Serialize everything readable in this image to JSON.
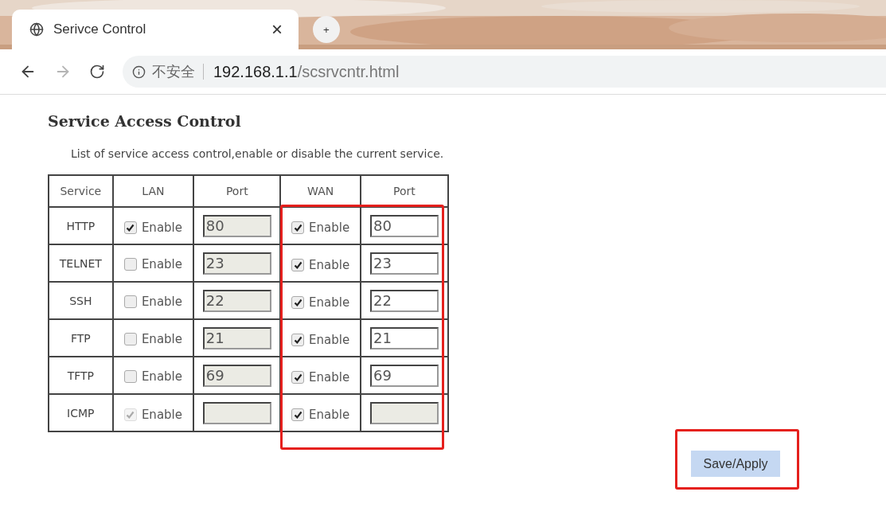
{
  "browser": {
    "tab": {
      "title": "Serivce Control",
      "close": "×"
    },
    "new_tab": "+",
    "forward_disabled": true,
    "address": {
      "security": "不安全",
      "host": "192.168.1.1",
      "path": "/scsrvcntr.html"
    }
  },
  "page": {
    "title": "Service Access Control",
    "description": "List of service access control,enable or disable the current service."
  },
  "table": {
    "columns": [
      "Service",
      "LAN",
      "Port",
      "WAN",
      "Port"
    ],
    "rows": [
      {
        "service": "HTTP",
        "lan": {
          "label": "Enable",
          "checked": true,
          "disabled": false
        },
        "lan_port": {
          "value": "80",
          "disabled": true
        },
        "wan": {
          "label": "Enable",
          "checked": true,
          "disabled": false
        },
        "wan_port": {
          "value": "80",
          "disabled": false
        }
      },
      {
        "service": "TELNET",
        "lan": {
          "label": "Enable",
          "checked": false,
          "disabled": false
        },
        "lan_port": {
          "value": "23",
          "disabled": true
        },
        "wan": {
          "label": "Enable",
          "checked": true,
          "disabled": false
        },
        "wan_port": {
          "value": "23",
          "disabled": false
        }
      },
      {
        "service": "SSH",
        "lan": {
          "label": "Enable",
          "checked": false,
          "disabled": false
        },
        "lan_port": {
          "value": "22",
          "disabled": true
        },
        "wan": {
          "label": "Enable",
          "checked": true,
          "disabled": false
        },
        "wan_port": {
          "value": "22",
          "disabled": false
        }
      },
      {
        "service": "FTP",
        "lan": {
          "label": "Enable",
          "checked": false,
          "disabled": false
        },
        "lan_port": {
          "value": "21",
          "disabled": true
        },
        "wan": {
          "label": "Enable",
          "checked": true,
          "disabled": false
        },
        "wan_port": {
          "value": "21",
          "disabled": false
        }
      },
      {
        "service": "TFTP",
        "lan": {
          "label": "Enable",
          "checked": false,
          "disabled": false
        },
        "lan_port": {
          "value": "69",
          "disabled": true
        },
        "wan": {
          "label": "Enable",
          "checked": true,
          "disabled": false
        },
        "wan_port": {
          "value": "69",
          "disabled": false
        }
      },
      {
        "service": "ICMP",
        "lan": {
          "label": "Enable",
          "checked": true,
          "disabled": true
        },
        "lan_port": {
          "disabled": true
        },
        "wan": {
          "label": "Enable",
          "checked": true,
          "disabled": false
        },
        "wan_port": {
          "disabled": true
        }
      }
    ]
  },
  "save_button": "Save/Apply"
}
